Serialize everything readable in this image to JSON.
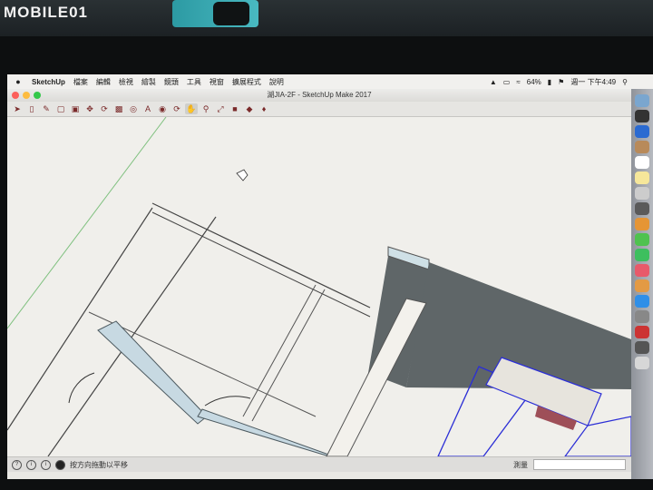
{
  "watermark": "MOBILE01",
  "menubar": {
    "app_name": "SketchUp",
    "items": [
      "檔案",
      "編輯",
      "檢視",
      "繪製",
      "鏡頭",
      "工具",
      "視窗",
      "擴展程式",
      "說明"
    ],
    "battery": "64%",
    "clock": "週一 下午4:49"
  },
  "window": {
    "title": "湖JIA-2F - SketchUp Make 2017"
  },
  "toolbar": {
    "tools": [
      "select-tool-icon",
      "eraser-tool-icon",
      "pencil-tool-icon",
      "shape-tool-icon",
      "push-pull-tool-icon",
      "move-tool-icon",
      "rotate-tool-icon",
      "scale-tool-icon",
      "tape-measure-icon",
      "text-tool-icon",
      "paint-bucket-icon",
      "orbit-tool-icon",
      "pan-tool-icon",
      "zoom-tool-icon",
      "zoom-extents-icon",
      "warehouse-icon",
      "extension-icon",
      "ruby-icon"
    ]
  },
  "status": {
    "hint": "按方向拖動以平移",
    "measure_label": "測量"
  },
  "colors": {
    "accent": "#2b2ed6",
    "wall_dark": "#5f6668",
    "wall_top": "#cfe0e6"
  }
}
